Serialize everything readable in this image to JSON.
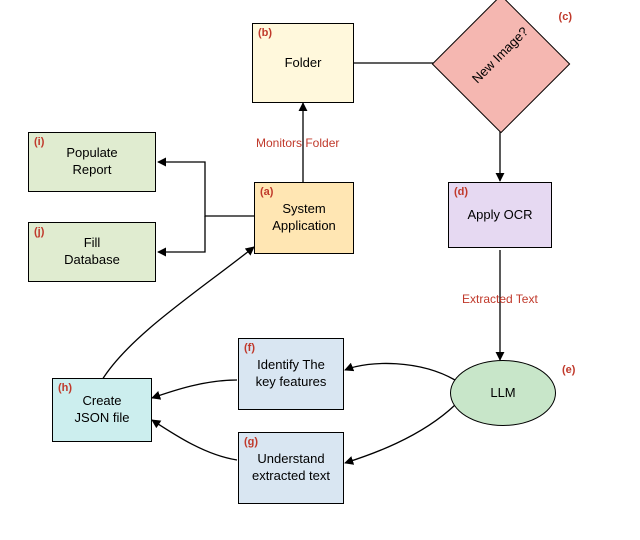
{
  "nodes": {
    "a": {
      "tag": "(a)",
      "text1": "System",
      "text2": "Application"
    },
    "b": {
      "tag": "(b)",
      "text1": "Folder",
      "text2": ""
    },
    "c": {
      "tag": "(c)",
      "text1": "New Image?",
      "text2": ""
    },
    "d": {
      "tag": "(d)",
      "text1": "Apply OCR",
      "text2": ""
    },
    "e": {
      "tag": "(e)",
      "text1": "LLM",
      "text2": ""
    },
    "f": {
      "tag": "(f)",
      "text1": "Identify The",
      "text2": "key features"
    },
    "g": {
      "tag": "(g)",
      "text1": "Understand",
      "text2": "extracted text"
    },
    "h": {
      "tag": "(h)",
      "text1": "Create",
      "text2": "JSON file"
    },
    "i": {
      "tag": "(i)",
      "text1": "Populate",
      "text2": "Report"
    },
    "j": {
      "tag": "(j)",
      "text1": "Fill",
      "text2": "Database"
    }
  },
  "edges": {
    "monitors": "Monitors Folder",
    "extracted": "Extracted Text"
  }
}
